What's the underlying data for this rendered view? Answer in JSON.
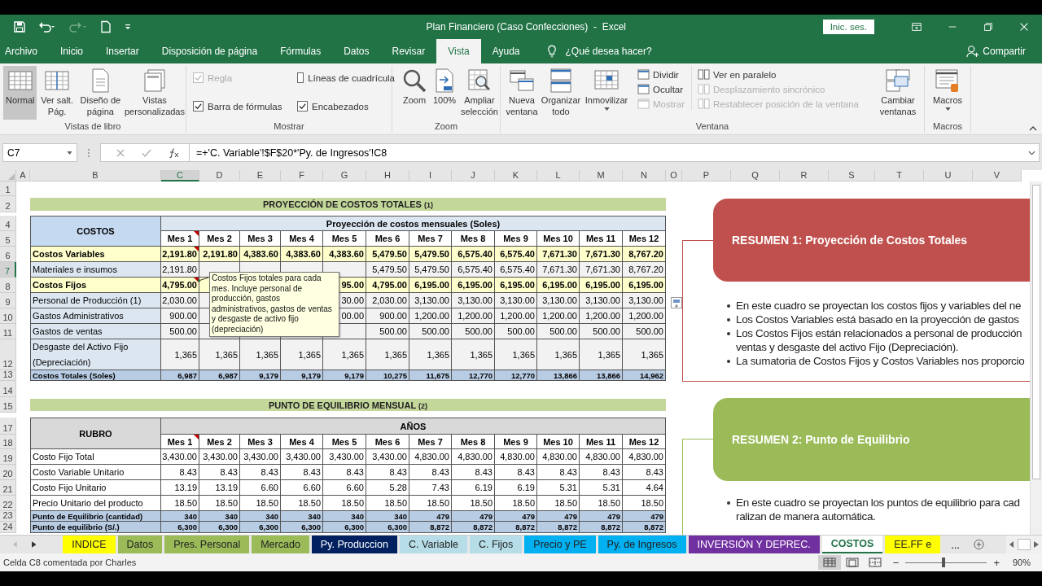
{
  "title_bar": {
    "title": "Plan Financiero (Caso Confecciones)  -  Excel",
    "sign_in": "Inic. ses."
  },
  "menu": [
    {
      "label": "Archivo",
      "selected": false
    },
    {
      "label": "Inicio",
      "selected": false
    },
    {
      "label": "Insertar",
      "selected": false
    },
    {
      "label": "Disposición de página",
      "selected": false
    },
    {
      "label": "Fórmulas",
      "selected": false
    },
    {
      "label": "Datos",
      "selected": false
    },
    {
      "label": "Revisar",
      "selected": false
    },
    {
      "label": "Vista",
      "selected": true
    },
    {
      "label": "Ayuda",
      "selected": false
    }
  ],
  "tell_me": "¿Qué desea hacer?",
  "share": "Compartir",
  "ribbon": {
    "vistas": {
      "label": "Vistas de libro",
      "buttons": [
        {
          "label": "Normal",
          "selected": true
        },
        {
          "label": "Ver salt. Pág.",
          "selected": false
        },
        {
          "label": "Diseño de página",
          "selected": false
        },
        {
          "label": "Vistas personalizadas",
          "selected": false
        }
      ]
    },
    "mostrar": {
      "label": "Mostrar",
      "options": [
        {
          "label": "Regla",
          "checked": true,
          "disabled": true
        },
        {
          "label": "Líneas de cuadrícula",
          "checked": false,
          "disabled": false
        },
        {
          "label": "Barra de fórmulas",
          "checked": true,
          "disabled": false
        },
        {
          "label": "Encabezados",
          "checked": true,
          "disabled": false
        }
      ]
    },
    "zoom": {
      "label": "Zoom",
      "buttons": [
        "Zoom",
        "100%",
        "Ampliar selección"
      ]
    },
    "ventana": {
      "label": "Ventana",
      "buttons": [
        "Nueva ventana",
        "Organizar todo",
        "Inmovilizar"
      ],
      "small": [
        {
          "label": "Dividir",
          "disabled": false
        },
        {
          "label": "Ocultar",
          "disabled": false
        },
        {
          "label": "Mostrar",
          "disabled": true
        },
        {
          "label": "Ver en paralelo",
          "disabled": false
        },
        {
          "label": "Desplazamiento sincrónico",
          "disabled": true
        },
        {
          "label": "Restablecer posición de la ventana",
          "disabled": true
        }
      ],
      "switch": "Cambiar ventanas"
    },
    "macros": {
      "label": "Macros",
      "button": "Macros"
    }
  },
  "formula_bar": {
    "name_box": "C7",
    "formula": "=+'C. Variable'!$F$20*'Py. de Ingresos'!C8"
  },
  "columns": [
    {
      "label": "A",
      "selected": false
    },
    {
      "label": "B",
      "selected": false
    },
    {
      "label": "C",
      "selected": true
    },
    {
      "label": "D",
      "selected": false
    },
    {
      "label": "E",
      "selected": false
    },
    {
      "label": "F",
      "selected": false
    },
    {
      "label": "G",
      "selected": false
    },
    {
      "label": "H",
      "selected": false
    },
    {
      "label": "I",
      "selected": false
    },
    {
      "label": "J",
      "selected": false
    },
    {
      "label": "K",
      "selected": false
    },
    {
      "label": "L",
      "selected": false
    },
    {
      "label": "M",
      "selected": false
    },
    {
      "label": "N",
      "selected": false
    },
    {
      "label": "O",
      "selected": false
    },
    {
      "label": "P",
      "selected": false
    },
    {
      "label": "Q",
      "selected": false
    },
    {
      "label": "R",
      "selected": false
    },
    {
      "label": "S",
      "selected": false
    },
    {
      "label": "T",
      "selected": false
    },
    {
      "label": "U",
      "selected": false
    },
    {
      "label": "V",
      "selected": false
    }
  ],
  "rows": [
    {
      "label": "1",
      "selected": false
    },
    {
      "label": "2",
      "selected": false
    },
    {
      "label": "4",
      "selected": false
    },
    {
      "label": "5",
      "selected": false
    },
    {
      "label": "6",
      "selected": false
    },
    {
      "label": "7",
      "selected": true
    },
    {
      "label": "8",
      "selected": false
    },
    {
      "label": "9",
      "selected": false
    },
    {
      "label": "10",
      "selected": false
    },
    {
      "label": "11",
      "selected": false
    },
    {
      "label": "12",
      "selected": false
    },
    {
      "label": "13",
      "selected": false
    },
    {
      "label": "14",
      "selected": false
    },
    {
      "label": "15",
      "selected": false
    },
    {
      "label": "17",
      "selected": false
    },
    {
      "label": "18",
      "selected": false
    },
    {
      "label": "19",
      "selected": false
    },
    {
      "label": "20",
      "selected": false
    },
    {
      "label": "21",
      "selected": false
    },
    {
      "label": "22",
      "selected": false
    },
    {
      "label": "23",
      "selected": false
    },
    {
      "label": "24",
      "selected": false
    }
  ],
  "tables": [
    {
      "kind": "blue",
      "title": "PROYECCIÓN DE COSTOS TOTALES",
      "note": "(1)",
      "corner": "COSTOS",
      "group": "Proyección de costos mensuales (Soles)",
      "months": [
        {
          "label": "Mes 1",
          "comment": true
        },
        {
          "label": "Mes 2",
          "comment": false
        },
        {
          "label": "Mes 3",
          "comment": false
        },
        {
          "label": "Mes 4",
          "comment": false
        },
        {
          "label": "Mes 5",
          "comment": false
        },
        {
          "label": "Mes 6",
          "comment": false
        },
        {
          "label": "Mes 7",
          "comment": false
        },
        {
          "label": "Mes 8",
          "comment": false
        },
        {
          "label": "Mes 9",
          "comment": false
        },
        {
          "label": "Mes 10",
          "comment": false
        },
        {
          "label": "Mes 11",
          "comment": false
        },
        {
          "label": "Mes 12",
          "comment": false
        }
      ],
      "rows": [
        {
          "kind": "subtotal",
          "label": "Costos Variables",
          "comment": true,
          "values": [
            "2,191.80",
            "2,191.80",
            "4,383.60",
            "4,383.60",
            "4,383.60",
            "5,479.50",
            "5,479.50",
            "6,575.40",
            "6,575.40",
            "7,671.30",
            "7,671.30",
            "8,767.20"
          ]
        },
        {
          "kind": "detail",
          "label": "Materiales e insumos",
          "comment": false,
          "first": "2,191.80",
          "rest": [
            "5,479.50",
            "5,479.50",
            "6,575.40",
            "6,575.40",
            "7,671.30",
            "7,671.30",
            "8,767.20"
          ]
        },
        {
          "kind": "subtotal",
          "label": "Costos Fijos",
          "comment": true,
          "first": "4,795.00",
          "partial": "95.00",
          "rest": [
            "4,795.00",
            "6,195.00",
            "6,195.00",
            "6,195.00",
            "6,195.00",
            "6,195.00",
            "6,195.00"
          ]
        },
        {
          "kind": "detail",
          "label": "Personal de Producción (1)",
          "comment": false,
          "first": "2,030.00",
          "partial": "30.00",
          "rest": [
            "2,030.00",
            "3,130.00",
            "3,130.00",
            "3,130.00",
            "3,130.00",
            "3,130.00",
            "3,130.00"
          ]
        },
        {
          "kind": "detail",
          "label": "Gastos  Administrativos",
          "comment": false,
          "first": "900.00",
          "partial": "00.00",
          "rest": [
            "900.00",
            "1,200.00",
            "1,200.00",
            "1,200.00",
            "1,200.00",
            "1,200.00",
            "1,200.00"
          ]
        },
        {
          "kind": "detail",
          "label": "Gastos de ventas",
          "comment": false,
          "first": "500.00",
          "rest": [
            "500.00",
            "500.00",
            "500.00",
            "500.00",
            "500.00",
            "500.00",
            "500.00"
          ]
        },
        {
          "kind": "detail",
          "label": "Desgaste del Activo Fijo (Depreciación)",
          "comment": false,
          "values": [
            "1,365",
            "1,365",
            "1,365",
            "1,365",
            "1,365",
            "1,365",
            "1,365",
            "1,365",
            "1,365",
            "1,365",
            "1,365",
            "1,365"
          ]
        },
        {
          "kind": "total",
          "label": "Costos Totales (Soles)",
          "comment": false,
          "values": [
            "6,987",
            "6,987",
            "9,179",
            "9,179",
            "9,179",
            "10,275",
            "11,675",
            "12,770",
            "12,770",
            "13,866",
            "13,866",
            "14,962"
          ]
        }
      ]
    },
    {
      "kind": "gray",
      "title": "PUNTO DE EQUILIBRIO MENSUAL",
      "note": "(2)",
      "corner": "RUBRO",
      "group": "AÑOS",
      "months": [
        {
          "label": "Mes 1",
          "comment": true
        },
        {
          "label": "Mes 2",
          "comment": false
        },
        {
          "label": "Mes 3",
          "comment": false
        },
        {
          "label": "Mes 4",
          "comment": false
        },
        {
          "label": "Mes 5",
          "comment": false
        },
        {
          "label": "Mes 6",
          "comment": false
        },
        {
          "label": "Mes 7",
          "comment": false
        },
        {
          "label": "Mes 8",
          "comment": false
        },
        {
          "label": "Mes 9",
          "comment": false
        },
        {
          "label": "Mes 10",
          "comment": false
        },
        {
          "label": "Mes 11",
          "comment": false
        },
        {
          "label": "Mes 12",
          "comment": false
        }
      ],
      "rows": [
        {
          "kind": "detail",
          "label": "Costo Fijo Total",
          "comment": false,
          "values": [
            "3,430.00",
            "3,430.00",
            "3,430.00",
            "3,430.00",
            "3,430.00",
            "3,430.00",
            "4,830.00",
            "4,830.00",
            "4,830.00",
            "4,830.00",
            "4,830.00",
            "4,830.00"
          ]
        },
        {
          "kind": "detail",
          "label": "Costo Variable Unitario",
          "comment": false,
          "values": [
            "8.43",
            "8.43",
            "8.43",
            "8.43",
            "8.43",
            "8.43",
            "8.43",
            "8.43",
            "8.43",
            "8.43",
            "8.43",
            "8.43"
          ]
        },
        {
          "kind": "detail",
          "label": "Costo Fijo Unitario",
          "comment": false,
          "values": [
            "13.19",
            "13.19",
            "6.60",
            "6.60",
            "6.60",
            "5.28",
            "7.43",
            "6.19",
            "6.19",
            "5.31",
            "5.31",
            "4.64"
          ]
        },
        {
          "kind": "detail",
          "label": "Precio Unitario del producto",
          "comment": false,
          "values": [
            "18.50",
            "18.50",
            "18.50",
            "18.50",
            "18.50",
            "18.50",
            "18.50",
            "18.50",
            "18.50",
            "18.50",
            "18.50",
            "18.50"
          ]
        },
        {
          "kind": "total",
          "label": "Punto de Equilibrio (cantidad)",
          "comment": false,
          "values": [
            "340",
            "340",
            "340",
            "340",
            "340",
            "340",
            "479",
            "479",
            "479",
            "479",
            "479",
            "479"
          ]
        },
        {
          "kind": "total",
          "label": "Punto de equilibrio (S/.)",
          "comment": false,
          "values": [
            "6,300",
            "6,300",
            "6,300",
            "6,300",
            "6,300",
            "6,300",
            "8,872",
            "8,872",
            "8,872",
            "8,872",
            "8,872",
            "8,872"
          ]
        }
      ]
    }
  ],
  "comment": "Costos Fijos totales para cada mes. Incluye personal de producción, gastos administrativos, gastos de ventas y desgaste de activo fijo (depreciación)",
  "summaries": [
    {
      "title": "RESUMEN 1: Proyección de Costos Totales",
      "color": "#c0504d",
      "bullets": [
        [
          "En este cuadro se proyectan los costos fijos y variables del ne"
        ],
        [
          "Los Costos Variables está basado en la proyección de gastos"
        ],
        [
          "Los Costos Fijos están relacionados a personal de producción",
          "ventas y desgaste del activo Fijo (Depreciación)."
        ],
        [
          "La sumatoria de Costos Fijos y Costos Variables nos proporcio"
        ]
      ]
    },
    {
      "title": "RESUMEN 2: Punto de Equilibrio",
      "color": "#9bbb59",
      "bullets": [
        [
          "En este cuadro se proyectan los puntos de equilibrio para cad",
          "ralizan de manera automática."
        ]
      ]
    }
  ],
  "sheet_tabs": [
    {
      "label": "INDICE",
      "color": "#ffff00",
      "selected": false
    },
    {
      "label": "Datos",
      "color": "#9bbb59",
      "selected": false
    },
    {
      "label": "Pres. Personal",
      "color": "#9bbb59",
      "selected": false
    },
    {
      "label": "Mercado",
      "color": "#9bbb59",
      "selected": false
    },
    {
      "label": "Py. Produccion",
      "color": "#002060",
      "selected": false
    },
    {
      "label": "C. Variable",
      "color": "#b7dee8",
      "selected": false
    },
    {
      "label": "C. Fijos",
      "color": "#b7dee8",
      "selected": false
    },
    {
      "label": "Precio y PE",
      "color": "#00b0f0",
      "selected": false
    },
    {
      "label": "Py. de Ingresos",
      "color": "#00b0f0",
      "selected": false
    },
    {
      "label": "INVERSIÓN Y DEPREC.",
      "color": "#7030a0",
      "selected": false
    },
    {
      "label": "COSTOS",
      "color": "#ffffff",
      "selected": true
    },
    {
      "label": "EE.FF e",
      "color": "#ffff00",
      "selected": false
    }
  ],
  "more_tabs": "...",
  "status_bar": {
    "message": "Celda C8 comentada por Charles",
    "zoom_out": "−",
    "zoom_in": "+",
    "zoom": "90%",
    "zoom_slider": {
      "level": 0.47
    }
  }
}
